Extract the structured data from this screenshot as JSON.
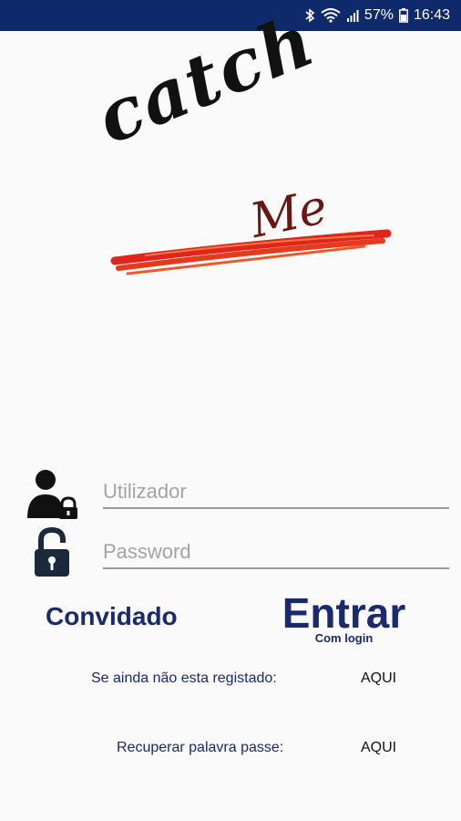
{
  "status_bar": {
    "battery": "57%",
    "time": "16:43",
    "icons": [
      "bluetooth-icon",
      "wifi-icon",
      "signal-icon",
      "battery-icon"
    ]
  },
  "logo": {
    "word1": "catch",
    "word2": "Me",
    "colors": {
      "word1": "#111111",
      "word2": "#6b1612",
      "stroke": "#e0261c"
    }
  },
  "login": {
    "username_placeholder": "Utilizador",
    "password_placeholder": "Password",
    "username_icon": "user-lock-icon",
    "password_icon": "padlock-icon"
  },
  "actions": {
    "guest_label": "Convidado",
    "enter_label": "Entrar",
    "enter_sublabel": "Com login"
  },
  "links": {
    "register_text": "Se ainda não esta registado:",
    "register_link": "AQUI",
    "recover_text": "Recuperar palavra passe:",
    "recover_link": "AQUI"
  },
  "colors": {
    "status_bar": "#0e2a6a",
    "primary_text": "#1a2a6c",
    "background": "#fafafa"
  }
}
